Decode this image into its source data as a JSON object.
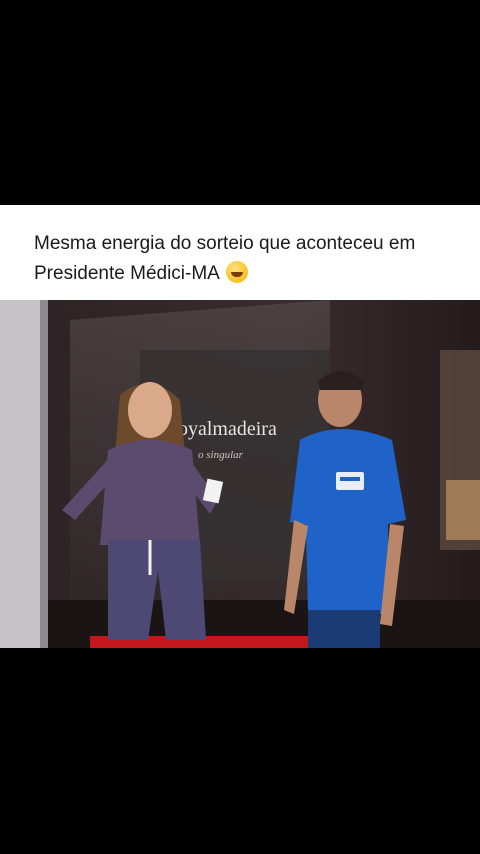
{
  "post": {
    "caption_line1": "Mesma energia do sorteio que aconteceu em",
    "caption_line2": "Presidente Médici-MA",
    "emoji": "rolling-on-floor-laughing-emoji"
  },
  "video": {
    "sign_text": "oyalmadeira",
    "sign_subtext": "o singular",
    "shirt_badge": "",
    "colors": {
      "backdrop": "#2a2022",
      "shirt": "#1f63c9",
      "stage_red": "#c4161c"
    }
  }
}
